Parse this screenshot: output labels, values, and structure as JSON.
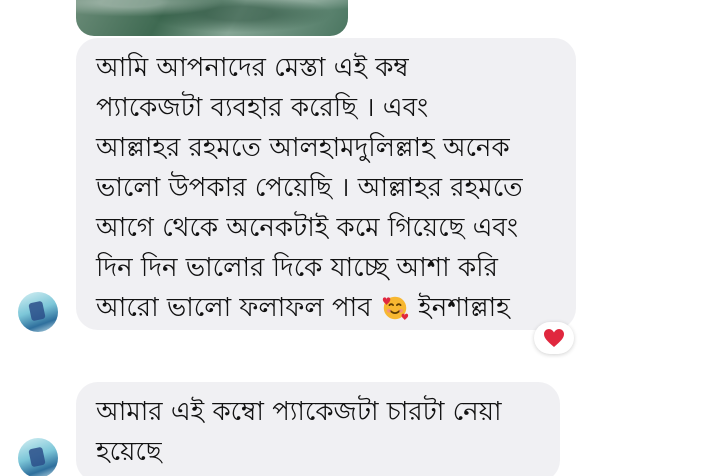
{
  "messages": [
    {
      "lines": [
        "আমি আপনাদের  মেস্তা এই কম্ব",
        "প্যাকেজটা ব্যবহার করেছি  । এবং",
        "আল্লাহর রহমতে আলহামদুলিল্লাহ অনেক",
        "ভালো উপকার পেয়েছি । আল্লাহর রহমতে",
        "আগে থেকে অনেকটাই কমে গিয়েছে এবং",
        "দিন দিন ভালোর দিকে যাচ্ছে আশা করি",
        "আরো ভালো ফলাফল পাব",
        "ইনশাল্লাহ"
      ],
      "inline_emoji": "smiling-face-with-hearts-icon",
      "reaction": "heart-icon"
    },
    {
      "lines": [
        "আমার এই কম্বো প্যাকেজটা চারটা নেয়া",
        "হয়েছে"
      ]
    }
  ],
  "colors": {
    "bubble_bg": "#f0f0f3",
    "text": "#111111",
    "reaction_heart": "#e0273e",
    "emoji_face": "#f7b731",
    "emoji_heart": "#e0273e"
  }
}
